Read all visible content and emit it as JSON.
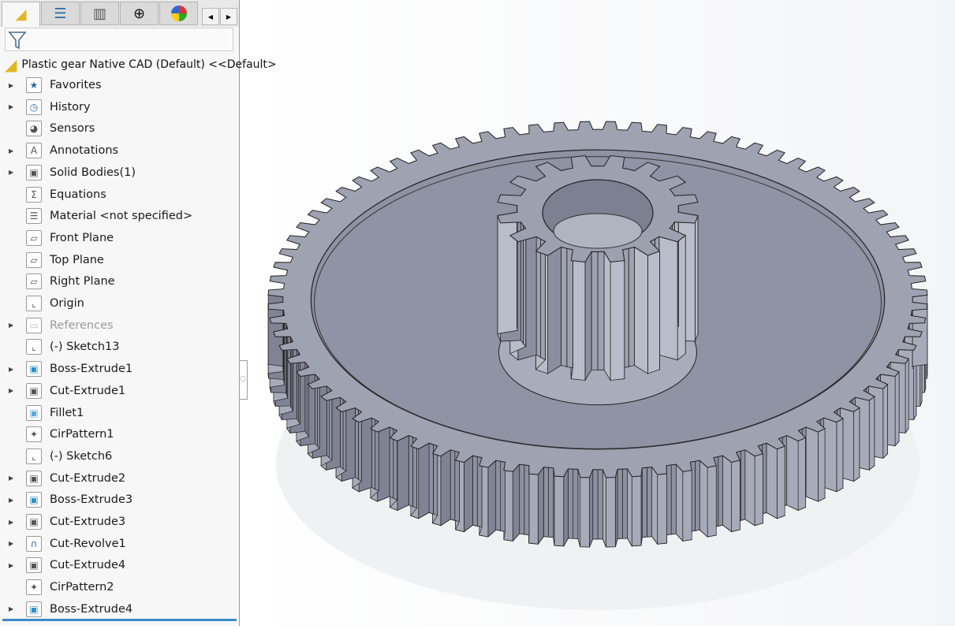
{
  "tabs": [
    {
      "name": "featuremanager",
      "icon": "part-icon"
    },
    {
      "name": "propertymanager",
      "icon": "property-list-icon"
    },
    {
      "name": "configurationmanager",
      "icon": "configuration-icon"
    },
    {
      "name": "dimxpert",
      "icon": "crosshair-icon"
    },
    {
      "name": "display-manager",
      "icon": "appearance-sphere-icon"
    }
  ],
  "filter": {
    "icon": "filter-icon",
    "value": ""
  },
  "tree": {
    "root": "Plastic gear Native CAD (Default) <<Default>",
    "items": [
      {
        "label": "Favorites",
        "icon": "favorites-folder-icon",
        "expandable": true
      },
      {
        "label": "History",
        "icon": "history-folder-icon",
        "expandable": true
      },
      {
        "label": "Sensors",
        "icon": "sensors-icon",
        "expandable": false
      },
      {
        "label": "Annotations",
        "icon": "annotations-icon",
        "expandable": true
      },
      {
        "label": "Solid Bodies(1)",
        "icon": "solid-bodies-icon",
        "expandable": true
      },
      {
        "label": "Equations",
        "icon": "equations-icon",
        "expandable": false
      },
      {
        "label": "Material <not specified>",
        "icon": "material-icon",
        "expandable": false
      },
      {
        "label": "Front Plane",
        "icon": "plane-icon",
        "expandable": false
      },
      {
        "label": "Top Plane",
        "icon": "plane-icon",
        "expandable": false
      },
      {
        "label": "Right Plane",
        "icon": "plane-icon",
        "expandable": false
      },
      {
        "label": "Origin",
        "icon": "origin-icon",
        "expandable": false
      },
      {
        "label": "References",
        "icon": "references-folder-icon",
        "expandable": true,
        "dimmed": true
      },
      {
        "label": "(-) Sketch13",
        "icon": "sketch-icon",
        "expandable": false
      },
      {
        "label": "Boss-Extrude1",
        "icon": "boss-extrude-icon",
        "expandable": true
      },
      {
        "label": "Cut-Extrude1",
        "icon": "cut-extrude-icon",
        "expandable": true
      },
      {
        "label": "Fillet1",
        "icon": "fillet-icon",
        "expandable": false
      },
      {
        "label": "CirPattern1",
        "icon": "circular-pattern-icon",
        "expandable": false
      },
      {
        "label": "(-) Sketch6",
        "icon": "sketch-icon",
        "expandable": false
      },
      {
        "label": "Cut-Extrude2",
        "icon": "cut-extrude-icon",
        "expandable": true
      },
      {
        "label": "Boss-Extrude3",
        "icon": "boss-extrude-icon",
        "expandable": true
      },
      {
        "label": "Cut-Extrude3",
        "icon": "cut-extrude-icon",
        "expandable": true
      },
      {
        "label": "Cut-Revolve1",
        "icon": "cut-revolve-icon",
        "expandable": true
      },
      {
        "label": "Cut-Extrude4",
        "icon": "cut-extrude-icon",
        "expandable": true
      },
      {
        "label": "CirPattern2",
        "icon": "circular-pattern-icon",
        "expandable": false
      },
      {
        "label": "Boss-Extrude4",
        "icon": "boss-extrude-icon",
        "expandable": true
      }
    ]
  },
  "colors": {
    "model": "#8f93a3",
    "model_top": "#9ea2b1",
    "accent": "#3e8ac8"
  }
}
